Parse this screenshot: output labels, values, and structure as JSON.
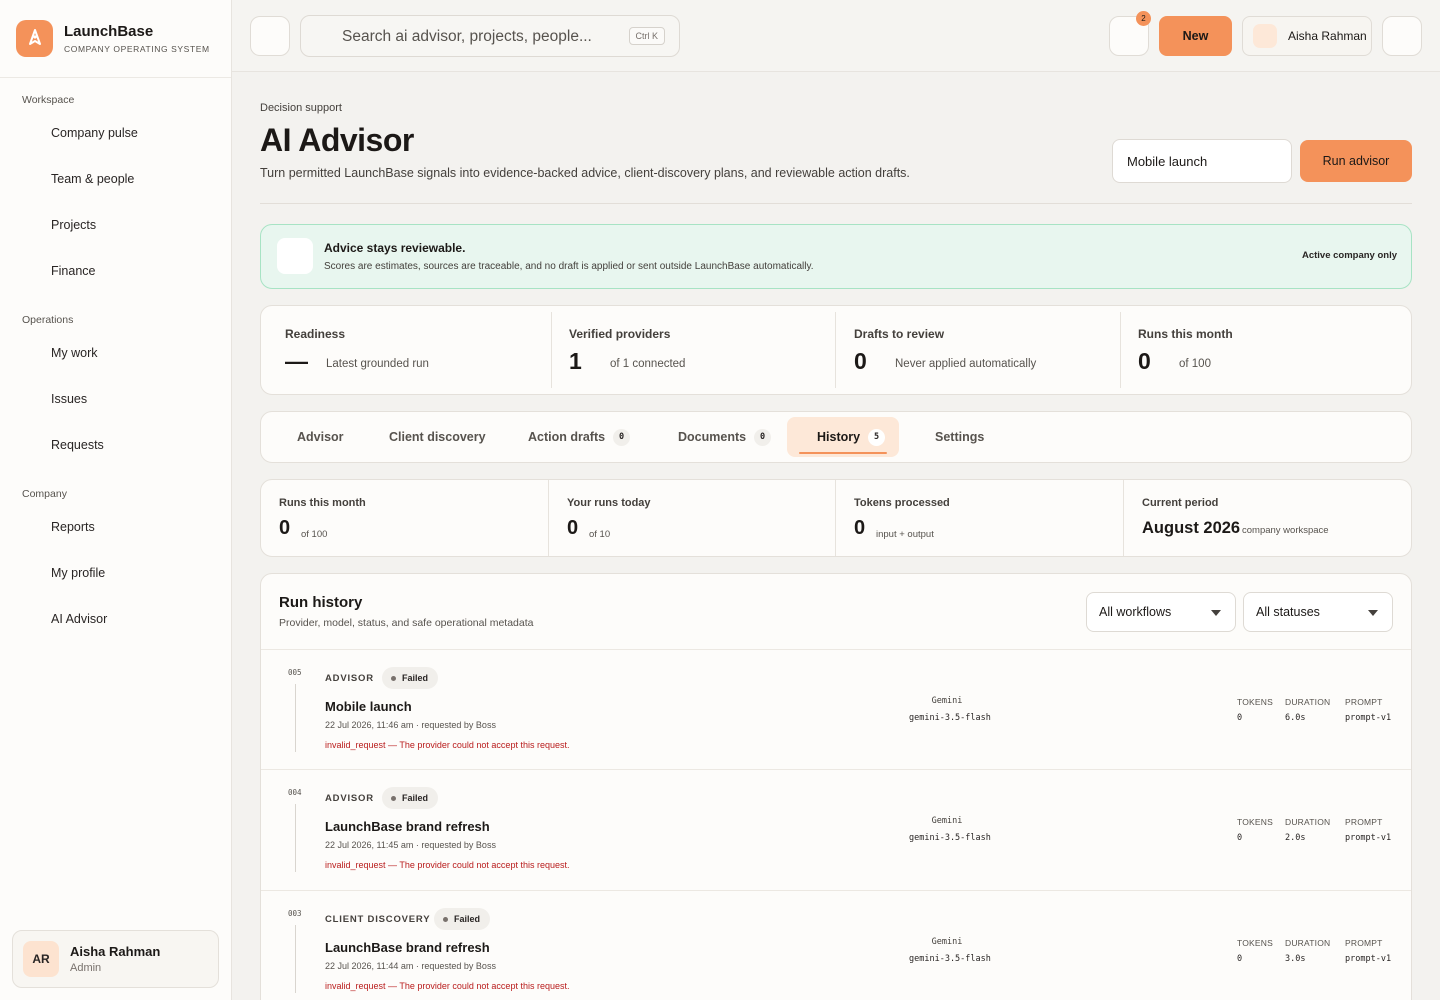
{
  "brand": {
    "name": "LaunchBase",
    "tagline": "COMPANY OPERATING SYSTEM"
  },
  "sidebar": {
    "sections": [
      {
        "title": "Workspace",
        "items": [
          "Company pulse",
          "Team & people",
          "Projects",
          "Finance"
        ]
      },
      {
        "title": "Operations",
        "items": [
          "My work",
          "Issues",
          "Requests"
        ]
      },
      {
        "title": "Company",
        "items": [
          "Reports",
          "My profile",
          "AI Advisor"
        ]
      }
    ],
    "profile": {
      "initials": "AR",
      "name": "Aisha Rahman",
      "role": "Admin"
    }
  },
  "topbar": {
    "search_placeholder": "Search ai advisor, projects, people...",
    "shortcut": "Ctrl K",
    "notification_count": "2",
    "new_label": "New",
    "user_name": "Aisha Rahman"
  },
  "page": {
    "eyebrow": "Decision support",
    "title": "AI Advisor",
    "description": "Turn permitted LaunchBase signals into evidence-backed advice, client-discovery plans, and reviewable action drafts.",
    "workflow_value": "Mobile launch",
    "run_label": "Run advisor"
  },
  "notice": {
    "title": "Advice stays reviewable.",
    "body": "Scores are estimates, sources are traceable, and no draft is applied or sent outside LaunchBase automatically.",
    "tag": "Active company only"
  },
  "stats": [
    {
      "label": "Readiness",
      "value": "—",
      "sub": "Latest grounded run"
    },
    {
      "label": "Verified providers",
      "value": "1",
      "sub": "of 1 connected"
    },
    {
      "label": "Drafts to review",
      "value": "0",
      "sub": "Never applied automatically"
    },
    {
      "label": "Runs this month",
      "value": "0",
      "sub": "of 100"
    }
  ],
  "tabs": [
    {
      "label": "Advisor",
      "count": ""
    },
    {
      "label": "Client discovery",
      "count": ""
    },
    {
      "label": "Action drafts",
      "count": "0"
    },
    {
      "label": "Documents",
      "count": "0"
    },
    {
      "label": "History",
      "count": "5",
      "active": true
    },
    {
      "label": "Settings",
      "count": ""
    }
  ],
  "usage": [
    {
      "label": "Runs this month",
      "value": "0",
      "sub": "of 100"
    },
    {
      "label": "Your runs today",
      "value": "0",
      "sub": "of 10"
    },
    {
      "label": "Tokens processed",
      "value": "0",
      "sub": "input + output"
    },
    {
      "label": "Current period",
      "value": "August 2026",
      "sub": "company workspace"
    }
  ],
  "history": {
    "title": "Run history",
    "subtitle": "Provider, model, status, and safe operational metadata",
    "workflow_filter": "All workflows",
    "status_filter": "All statuses",
    "metric_headers": {
      "tokens": "TOKENS",
      "duration": "DURATION",
      "prompt": "PROMPT"
    },
    "runs": [
      {
        "id": "005",
        "workflow": "ADVISOR",
        "status": "Failed",
        "title": "Mobile launch",
        "meta": "22 Jul 2026, 11:46 am · requested by Boss",
        "error": "invalid_request — The provider could not accept this request.",
        "provider": "Gemini",
        "model": "gemini-3.5-flash",
        "tokens": "0",
        "duration": "6.0s",
        "prompt": "prompt-v1"
      },
      {
        "id": "004",
        "workflow": "ADVISOR",
        "status": "Failed",
        "title": "LaunchBase brand refresh",
        "meta": "22 Jul 2026, 11:45 am · requested by Boss",
        "error": "invalid_request — The provider could not accept this request.",
        "provider": "Gemini",
        "model": "gemini-3.5-flash",
        "tokens": "0",
        "duration": "2.0s",
        "prompt": "prompt-v1"
      },
      {
        "id": "003",
        "workflow": "CLIENT DISCOVERY",
        "status": "Failed",
        "title": "LaunchBase brand refresh",
        "meta": "22 Jul 2026, 11:44 am · requested by Boss",
        "error": "invalid_request — The provider could not accept this request.",
        "provider": "Gemini",
        "model": "gemini-3.5-flash",
        "tokens": "0",
        "duration": "3.0s",
        "prompt": "prompt-v1"
      }
    ]
  },
  "colors": {
    "accent": "#f4925a",
    "notice_bg": "#e8f6ef",
    "notice_border": "#a7e3c4",
    "error": "#b91c1c"
  },
  "icons": {
    "logo": "rocket-icon",
    "menu": "menu-icon",
    "search": "search-icon",
    "notification": "bell-icon",
    "settings": "gear-icon",
    "notice": "shield-check-icon"
  }
}
